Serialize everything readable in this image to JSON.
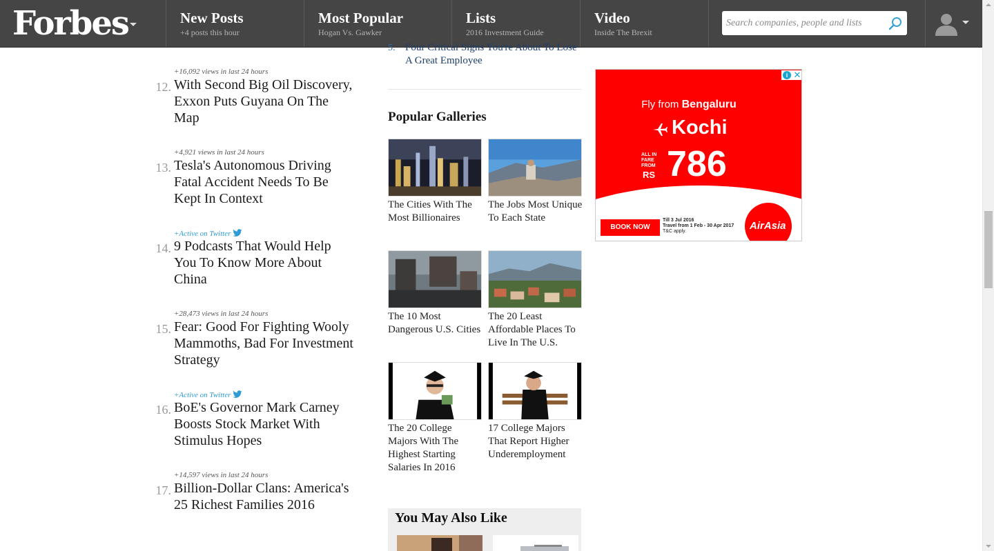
{
  "header": {
    "logo": "Forbes",
    "nav": [
      {
        "title": "New Posts",
        "sub": "+4 posts this hour"
      },
      {
        "title": "Most Popular",
        "sub": "Hogan Vs. Gawker"
      },
      {
        "title": "Lists",
        "sub": "2016 Investment Guide"
      },
      {
        "title": "Video",
        "sub": "Inside The Brexit"
      }
    ],
    "search_placeholder": "Search companies, people and lists",
    "icons": {
      "search": "search-icon",
      "user": "avatar-icon",
      "menu": "chevron-down-icon"
    }
  },
  "most_popular": {
    "entries": [
      {
        "num": "12.",
        "meta": "+16,092 views in last 24 hours",
        "title": "With Second Big Oil Discovery, Exxon Puts Guyana On The Map"
      },
      {
        "num": "13.",
        "meta": "+4,921 views in last 24 hours",
        "title": "Tesla's Autonomous Driving Fatal Accident Needs To Be Kept In Context"
      },
      {
        "num": "14.",
        "meta": "+Active on Twitter",
        "title": "9 Podcasts That Would Help You To Know More About China"
      },
      {
        "num": "15.",
        "meta": "+28,473 views in last 24 hours",
        "title": "Fear: Good For Fighting Wooly Mammoths, Bad For Investment Strategy"
      },
      {
        "num": "16.",
        "meta": "+Active on Twitter",
        "title": "BoE's Governor Mark Carney Boosts Stock Market With Stimulus Hopes"
      },
      {
        "num": "17.",
        "meta": "+14,597 views in last 24 hours",
        "title": "Billion-Dollar Clans: America's 25 Richest Families 2016"
      }
    ]
  },
  "center": {
    "top_item": {
      "num": "5.",
      "title": "Four Critical Signs You're About To Lose A Great Employee"
    },
    "galleries_heading": "Popular Galleries",
    "galleries": [
      {
        "caption": "The Cities With The Most Billionaires"
      },
      {
        "caption": "The Jobs Most Unique To Each State"
      },
      {
        "caption": "The 10 Most Dangerous U.S. Cities"
      },
      {
        "caption": "The 20 Least Affordable Places To Live In The U.S."
      },
      {
        "caption": "The 20 College Majors With The Highest Starting Salaries In 2016"
      },
      {
        "caption": "17 College Majors That Report Higher Underemployment"
      }
    ],
    "also_like_heading": "You May Also Like"
  },
  "ad": {
    "fly_from": "Fly from",
    "origin": "Bengaluru",
    "destination": "Kochi",
    "all_in": [
      "ALL IN",
      "FARE",
      "FROM"
    ],
    "currency": "RS",
    "price": "786",
    "cta": "BOOK NOW",
    "terms": [
      "Till 3 Jul 2016",
      "Travel from 1 Feb - 30 Apr 2017",
      "T&C apply."
    ],
    "brand": "AirAsia",
    "info": "i",
    "close": "✕"
  }
}
